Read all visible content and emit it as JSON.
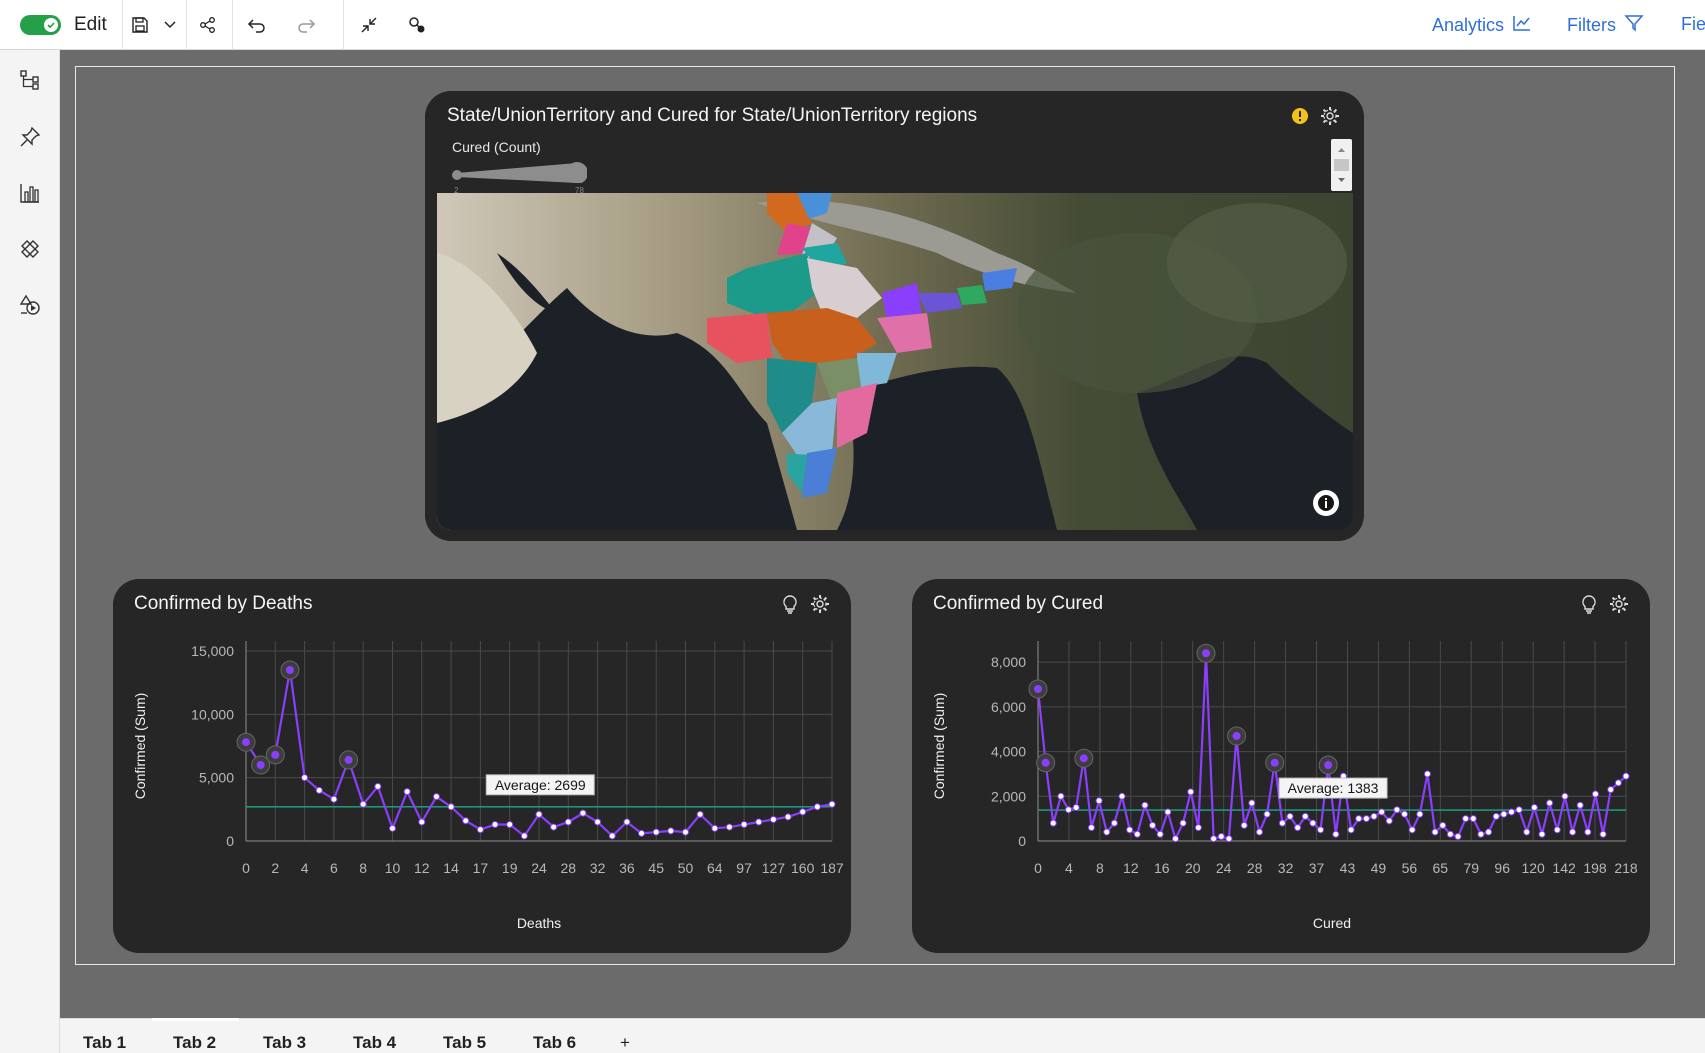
{
  "toolbar": {
    "edit_label": "Edit",
    "analytics_label": "Analytics",
    "filters_label": "Filters",
    "fields_label": "Fie",
    "accent": "#2f6fdb",
    "toggle_color": "#24a148"
  },
  "map_card": {
    "title": "State/UnionTerritory and Cured for State/UnionTerritory regions",
    "slider_label": "Cured (Count)",
    "slider_min": "2",
    "slider_max": "78",
    "warning_color": "#f1c21b"
  },
  "chart_data": [
    {
      "type": "line",
      "title": "Confirmed by Deaths",
      "xlabel": "Deaths",
      "ylabel": "Confirmed (Sum)",
      "ylim": [
        0,
        15000
      ],
      "yticks": [
        "0",
        "5,000",
        "10,000",
        "15,000"
      ],
      "xtick_labels": [
        "0",
        "2",
        "4",
        "6",
        "8",
        "10",
        "12",
        "14",
        "17",
        "19",
        "24",
        "28",
        "32",
        "36",
        "45",
        "50",
        "64",
        "97",
        "127",
        "160",
        "187"
      ],
      "average_label": "Average: 2699",
      "average": 2699,
      "color": "#8a3ffc",
      "grid": true,
      "values": [
        7800,
        6000,
        6800,
        13500,
        5000,
        4000,
        3300,
        6400,
        2900,
        4300,
        1000,
        3900,
        1500,
        3500,
        2700,
        1600,
        900,
        1300,
        1300,
        400,
        2100,
        1100,
        1500,
        2200,
        1500,
        400,
        1500,
        600,
        700,
        800,
        700,
        2100,
        1000,
        1100,
        1300,
        1500,
        1700,
        1900,
        2300,
        2700,
        2900
      ],
      "highlighted_indices": [
        0,
        1,
        2,
        3,
        7
      ]
    },
    {
      "type": "line",
      "title": "Confirmed by Cured",
      "xlabel": "Cured",
      "ylabel": "Confirmed (Sum)",
      "ylim": [
        0,
        8500
      ],
      "yticks": [
        "0",
        "2,000",
        "4,000",
        "6,000",
        "8,000"
      ],
      "xtick_labels": [
        "0",
        "4",
        "8",
        "12",
        "16",
        "20",
        "24",
        "28",
        "32",
        "37",
        "43",
        "49",
        "56",
        "65",
        "79",
        "96",
        "120",
        "142",
        "198",
        "218"
      ],
      "average_label": "Average: 1383",
      "average": 1383,
      "color": "#8a3ffc",
      "grid": true,
      "values": [
        6800,
        3500,
        800,
        2000,
        1400,
        1500,
        3700,
        600,
        1800,
        400,
        800,
        2000,
        500,
        300,
        1600,
        700,
        300,
        1300,
        100,
        800,
        2200,
        600,
        8400,
        100,
        200,
        100,
        4700,
        700,
        1700,
        400,
        1200,
        3500,
        800,
        1100,
        600,
        1100,
        800,
        500,
        3400,
        300,
        2900,
        500,
        1000,
        1000,
        1100,
        1300,
        900,
        1400,
        1200,
        500,
        1200,
        3000,
        400,
        700,
        300,
        200,
        1000,
        1000,
        300,
        400,
        1100,
        1200,
        1300,
        1400,
        400,
        1500,
        300,
        1700,
        500,
        2000,
        400,
        1600,
        400,
        2100,
        300,
        2300,
        2600,
        2900
      ],
      "highlighted_indices": [
        0,
        1,
        6,
        22,
        26,
        31,
        38
      ]
    }
  ],
  "tabs": [
    "Tab 1",
    "Tab 2",
    "Tab 3",
    "Tab 4",
    "Tab 5",
    "Tab 6"
  ],
  "add_tab": "+",
  "active_tab": 1
}
